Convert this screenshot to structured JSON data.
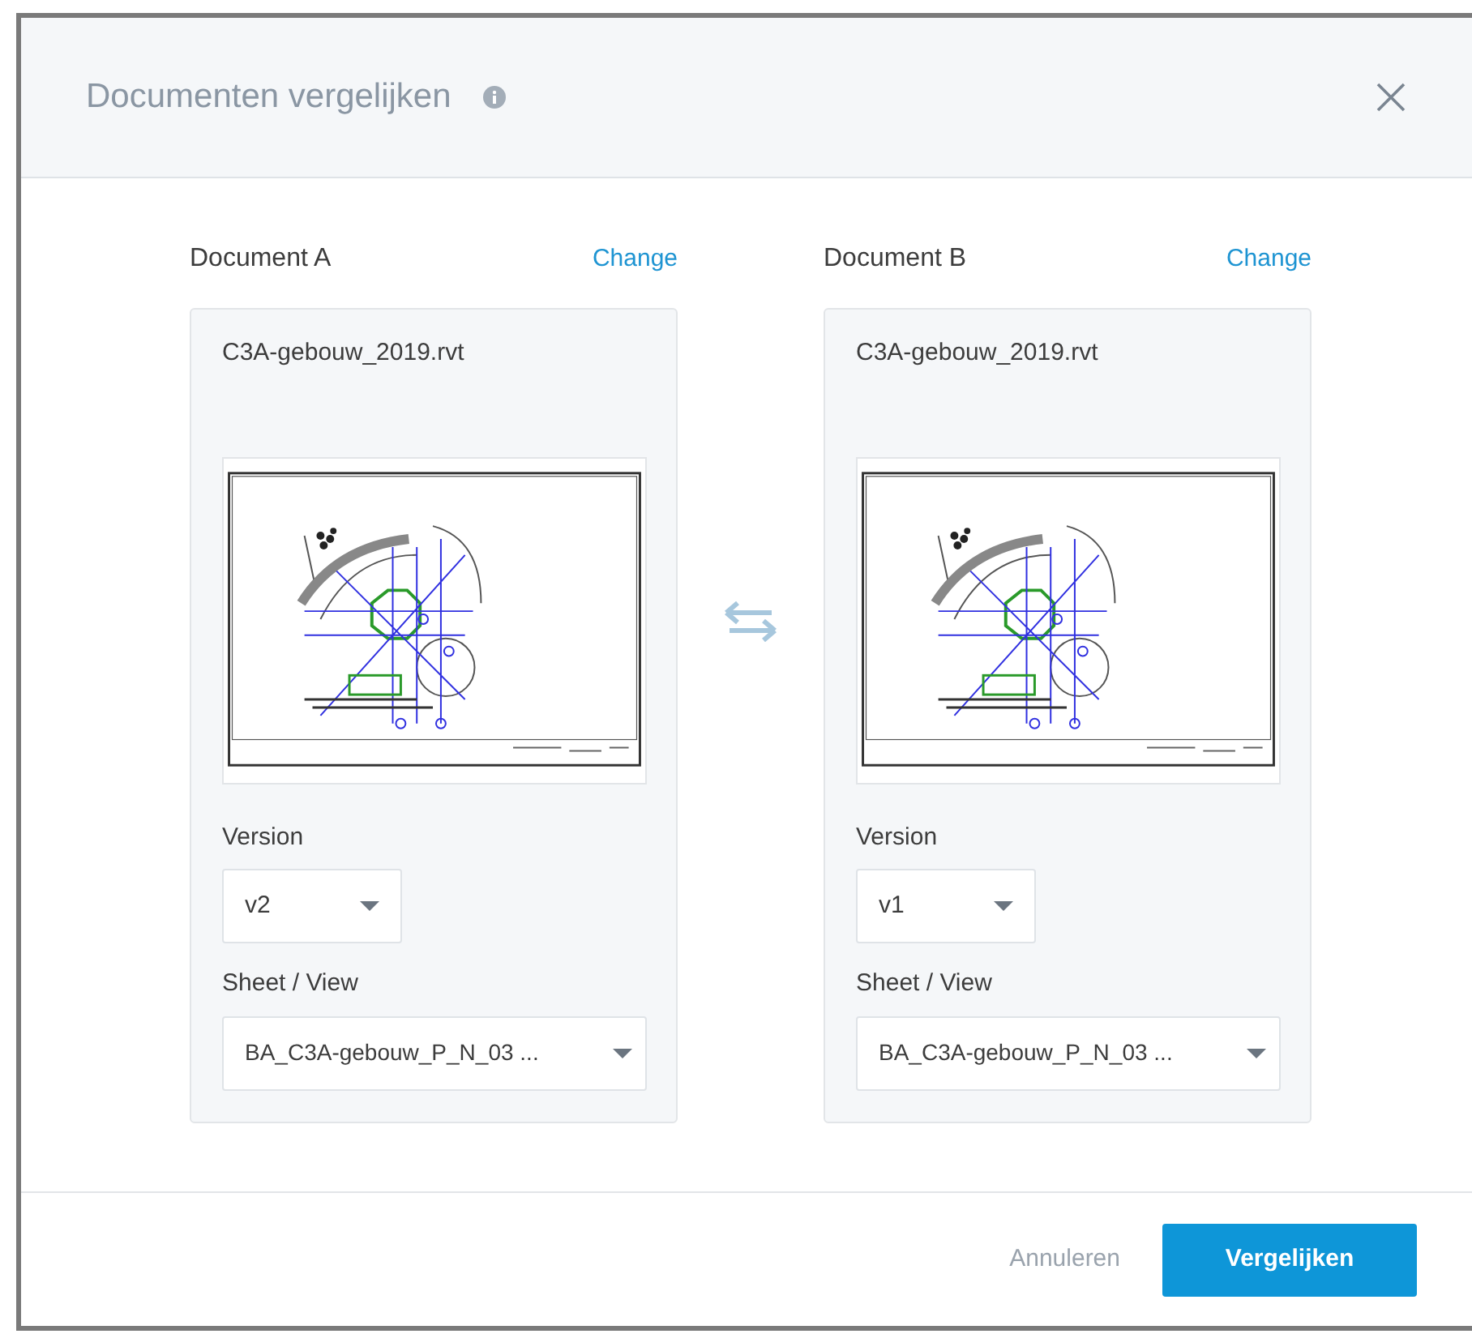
{
  "dialog": {
    "title": "Documenten vergelijken"
  },
  "documents": [
    {
      "label": "Document A",
      "change": "Change",
      "file": "C3A-gebouw_2019.rvt",
      "version_label": "Version",
      "version": "v2",
      "sheet_label": "Sheet / View",
      "sheet": "BA_C3A-gebouw_P_N_03 ..."
    },
    {
      "label": "Document B",
      "change": "Change",
      "file": "C3A-gebouw_2019.rvt",
      "version_label": "Version",
      "version": "v1",
      "sheet_label": "Sheet / View",
      "sheet": "BA_C3A-gebouw_P_N_03 ..."
    }
  ],
  "buttons": {
    "cancel": "Annuleren",
    "confirm": "Vergelijken"
  }
}
